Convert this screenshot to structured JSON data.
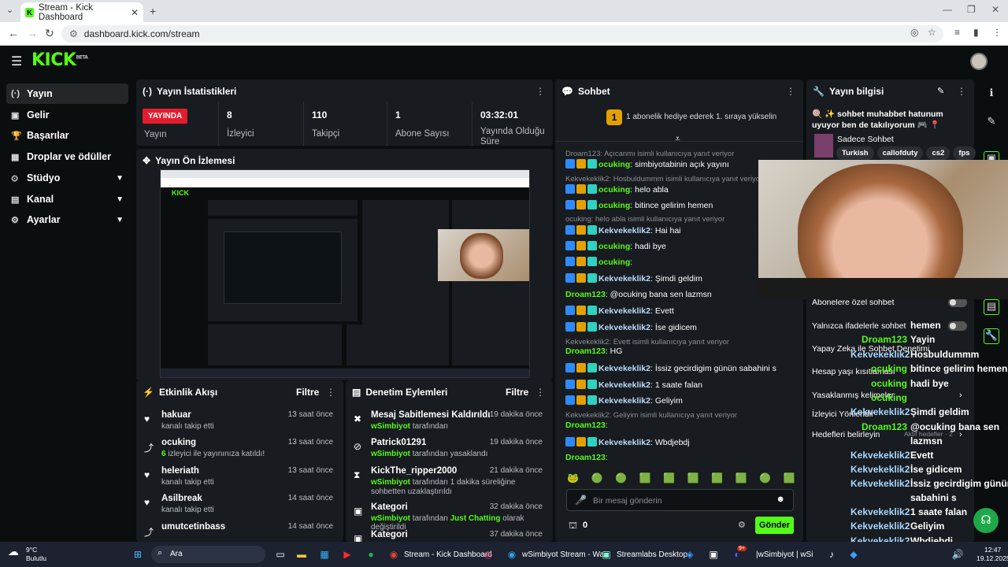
{
  "browser": {
    "tab_title": "Stream - Kick Dashboard",
    "url": "dashboard.kick.com/stream"
  },
  "kick": {
    "logo": "KICK",
    "logo_beta": "BETA"
  },
  "sidebar": {
    "items": [
      {
        "label": "Yayın",
        "icon": "stream-icon"
      },
      {
        "label": "Gelir",
        "icon": "revenue-icon"
      },
      {
        "label": "Başarılar",
        "icon": "trophy-icon"
      },
      {
        "label": "Droplar ve ödüller",
        "icon": "gift-icon"
      },
      {
        "label": "Stüdyo",
        "icon": "studio-icon"
      },
      {
        "label": "Kanal",
        "icon": "channel-icon"
      },
      {
        "label": "Ayarlar",
        "icon": "gear-icon"
      }
    ]
  },
  "stats": {
    "title": "Yayın İstatistikleri",
    "live_badge": "YAYINDA",
    "status_label": "Yayın",
    "viewers_value": "8",
    "viewers_label": "İzleyici",
    "followers_value": "110",
    "followers_label": "Takipçi",
    "subs_value": "1",
    "subs_label": "Abone Sayısı",
    "uptime_value": "03:32:01",
    "uptime_label": "Yayında Olduğu Süre"
  },
  "preview": {
    "title": "Yayın Ön İzlemesi"
  },
  "activity": {
    "title": "Etkinlik Akışı",
    "filter": "Filtre",
    "items": [
      {
        "name": "hakuar",
        "desc": "kanalı takip etti",
        "time": "13 saat önce"
      },
      {
        "name": "ocuking",
        "desc_count": "6",
        "desc": "izleyici ile yayınınıza katıldı!",
        "time": "13 saat önce"
      },
      {
        "name": "heleriath",
        "desc": "kanalı takip etti",
        "time": "13 saat önce"
      },
      {
        "name": "Asilbreak",
        "desc": "kanalı takip etti",
        "time": "14 saat önce"
      },
      {
        "name": "umutcetinbass",
        "desc": "",
        "time": "14 saat önce"
      }
    ]
  },
  "moderation": {
    "title": "Denetim Eylemleri",
    "filter": "Filtre",
    "items": [
      {
        "name": "Mesaj Sabitlemesi Kaldırıldı",
        "by": "wSimbiyot",
        "desc": "tarafından",
        "time": "19 dakika önce"
      },
      {
        "name": "Patrick01291",
        "by": "wSimbiyot",
        "desc": "tarafından yasaklandı",
        "time": "19 dakika önce"
      },
      {
        "name": "KickThe_ripper2000",
        "by": "wSimbiyot",
        "desc": "tarafından 1 dakika süreliğine sohbetten uzaklaştırıldı",
        "time": "21 dakika önce"
      },
      {
        "name": "Kategori",
        "by": "wSimbiyot",
        "desc": "tarafından",
        "extra": "Just Chatting",
        "desc2": "olarak değiştirildi",
        "time": "32 dakika önce"
      },
      {
        "name": "Kategori",
        "by": "",
        "desc": "",
        "time": "37 dakika önce"
      }
    ]
  },
  "chat": {
    "title": "Sohbet",
    "gift_count": "1",
    "gift_text": "1 abonelik hediye ederek 1. sıraya yükselin",
    "messages": [
      {
        "reply": "Droam123: Açıcanmı isimli kullanıcıya yanıt veriyor"
      },
      {
        "user": "ocuking",
        "text": "simbiyotabinin açık yayını",
        "color": "grn",
        "badges": true
      },
      {
        "reply": "Kekvekeklik2: Hosbuldummm isimli kullanıcıya yanıt veriyor"
      },
      {
        "user": "ocuking",
        "text": "helo abla",
        "color": "grn",
        "badges": true
      },
      {
        "user": "ocuking",
        "text": "bitince gelirim hemen",
        "color": "grn",
        "badges": true
      },
      {
        "reply": "ocuking: helo abla isimli kullanıcıya yanıt veriyor"
      },
      {
        "user": "Kekvekeklik2",
        "text": "Hai hai",
        "color": "blu",
        "badges": true
      },
      {
        "user": "ocuking",
        "text": "hadi bye",
        "color": "grn",
        "badges": true
      },
      {
        "user": "ocuking",
        "text": "",
        "color": "grn",
        "badges": true
      },
      {
        "user": "Kekvekeklik2",
        "text": "Şimdi geldim",
        "color": "blu",
        "badges": true
      },
      {
        "user": "Droam123",
        "text": "@ocuking bana sen lazmsn",
        "color": "grn",
        "badges": false
      },
      {
        "user": "Kekvekeklik2",
        "text": "Evett",
        "color": "blu",
        "badges": true
      },
      {
        "user": "Kekvekeklik2",
        "text": "İse gidicem",
        "color": "blu",
        "badges": true
      },
      {
        "reply": "Kekvekeklik2: Evett isimli kullanıcıya yanıt veriyor"
      },
      {
        "user": "Droam123",
        "text": "HG",
        "color": "grn",
        "badges": false
      },
      {
        "user": "Kekvekeklik2",
        "text": "İssiz gecirdigim günün sabahini s",
        "color": "blu",
        "badges": true
      },
      {
        "user": "Kekvekeklik2",
        "text": "1 saate falan",
        "color": "blu",
        "badges": true
      },
      {
        "user": "Kekvekeklik2",
        "text": "Geliyim",
        "color": "blu",
        "badges": true
      },
      {
        "reply": "Kekvekeklik2: Geliyim isimli kullanıcıya yanıt veriyor"
      },
      {
        "user": "Droam123",
        "text": "",
        "color": "grn",
        "badges": false
      },
      {
        "user": "Kekvekeklik2",
        "text": "Wbdjebdj",
        "color": "blu",
        "badges": true
      },
      {
        "user": "Droam123",
        "text": "",
        "color": "grn",
        "badges": false
      }
    ],
    "input_placeholder": "Bir mesaj gönderin",
    "points": "0",
    "send_label": "Gönder"
  },
  "info": {
    "title": "Yayın bilgisi",
    "stream_title": "🍭 ✨ sohbet muhabbet hatunum uyuyor ben de takılıyorum 🎮 📍",
    "category": "Sadece Sohbet",
    "tags": [
      "Turkish",
      "callofduty",
      "cs2",
      "fps"
    ],
    "settings": [
      {
        "label": "Abonelere özel sohbet"
      },
      {
        "label": "Yalnızca ifadelerle sohbet"
      },
      {
        "label": "Yapay Zeka ile Sohbet Denetimi"
      },
      {
        "label": "Hesap yaşı kısıtlaması"
      },
      {
        "label": "Yasaklanmış kelimeler"
      },
      {
        "label": "İzleyici Yönlendir"
      },
      {
        "label": "Hedefleri belirleyin",
        "sub": "Aktif hedefler · 2"
      }
    ]
  },
  "overlay_chat": [
    {
      "user": "",
      "text": "hemen"
    },
    {
      "user": "Droam123",
      "text": "Yayin",
      "green": true
    },
    {
      "user": "Kekvekeklik2",
      "text": "Hosbuldummm"
    },
    {
      "user": "ocuking",
      "text": "bitince gelirim hemen",
      "green": true
    },
    {
      "user": "ocuking",
      "text": "hadi bye",
      "green": true
    },
    {
      "user": "ocuking",
      "text": "",
      "green": true
    },
    {
      "user": "Kekvekeklik2",
      "text": "Şimdi geldim"
    },
    {
      "user": "Droam123",
      "text": "@ocuking bana sen",
      "green": true
    },
    {
      "user": "",
      "text": "lazmsn"
    },
    {
      "user": "Kekvekeklik2",
      "text": "Evett"
    },
    {
      "user": "Kekvekeklik2",
      "text": "İse gidicem"
    },
    {
      "user": "Kekvekeklik2",
      "text": "İssiz gecirdigim günün"
    },
    {
      "user": "",
      "text": "sabahini s"
    },
    {
      "user": "Kekvekeklik2",
      "text": "1 saate falan"
    },
    {
      "user": "Kekvekeklik2",
      "text": "Geliyim"
    },
    {
      "user": "Kekvekeklik2",
      "text": "Wbdjebdj"
    },
    {
      "user": "Droam123",
      "text": "",
      "green": true
    }
  ],
  "taskbar": {
    "weather_temp": "9°C",
    "weather_desc": "Bulutlu",
    "search": "Ara",
    "apps": [
      {
        "label": "Stream - Kick Dashboard"
      },
      {
        "label": "wSimbiyot Stream - Wa"
      },
      {
        "label": "Streamlabs Desktop"
      },
      {
        "label": "|wSimbiyot | wSi"
      }
    ],
    "discord_badge": "9+",
    "time": "12:47",
    "date": "19.12.2025"
  }
}
